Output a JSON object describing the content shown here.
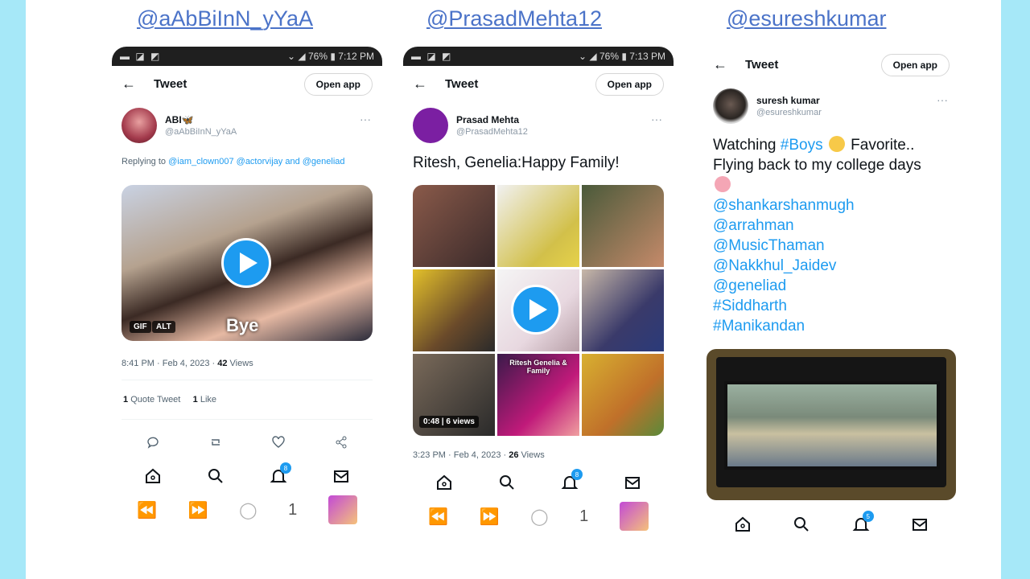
{
  "handles": [
    "@aAbBiInN_yYaA",
    "@PrasadMehta12",
    "@esureshkumar"
  ],
  "phone1": {
    "status_time": "7:12 PM",
    "status_battery": "76%",
    "title": "Tweet",
    "open_app": "Open app",
    "display_name": "ABI🦋",
    "handle": "@aAbBiInN_yYaA",
    "replying_prefix": "Replying to",
    "replying_to": "@iam_clown007 @actorvijay and @geneliad",
    "media_tags": [
      "GIF",
      "ALT"
    ],
    "media_caption": "Bye",
    "time": "8:41 PM · Feb 4, 2023 ·",
    "views_count": "42",
    "views_label": "Views",
    "quote_count": "1",
    "quote_label": "Quote Tweet",
    "like_count": "1",
    "like_label": "Like",
    "notif_badge": "8",
    "sys_page": "1"
  },
  "phone2": {
    "status_time": "7:13 PM",
    "status_battery": "76%",
    "title": "Tweet",
    "open_app": "Open app",
    "display_name": "Prasad Mehta",
    "handle": "@PrasadMehta12",
    "tweet_text": "Ritesh, Genelia:Happy Family!",
    "collage_text": "Ritesh Genelia & Family",
    "media_tag": "0:48",
    "media_views": "6 views",
    "time": "3:23 PM · Feb 4, 2023 ·",
    "views_count": "26",
    "views_label": "Views",
    "notif_badge": "8",
    "sys_page": "1"
  },
  "phone3": {
    "title": "Tweet",
    "open_app": "Open app",
    "display_name": "suresh kumar",
    "handle": "@esureshkumar",
    "text_pre": "Watching",
    "hashtag_boys": "#Boys",
    "text_post": "Favorite..",
    "text_line2": "Flying back to my college days",
    "tags": [
      "@shankarshanmugh",
      "@arrahman",
      "@MusicThaman",
      "@Nakkhul_Jaidev",
      "@geneliad",
      "#Siddharth",
      "#Manikandan"
    ],
    "notif_badge": "5"
  }
}
